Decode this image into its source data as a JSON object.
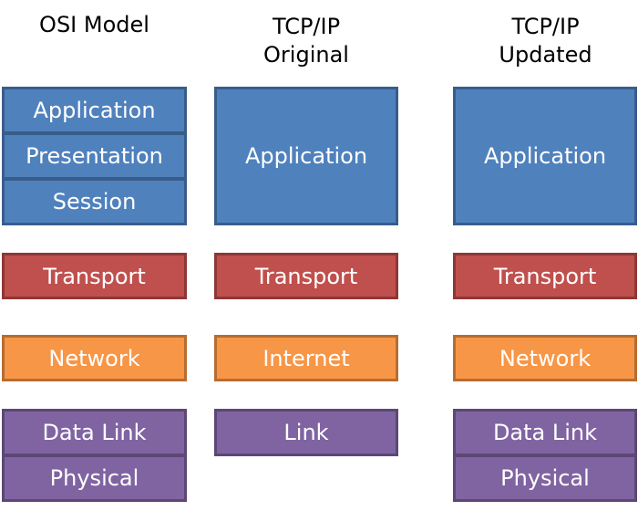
{
  "colors": {
    "application": "#4f81bd",
    "transport": "#c0504d",
    "network": "#f79646",
    "link": "#8064a2"
  },
  "columns": [
    {
      "title": "OSI Model",
      "layers": [
        "Application",
        "Presentation",
        "Session",
        "Transport",
        "Network",
        "Data Link",
        "Physical"
      ]
    },
    {
      "title": "TCP/IP\nOriginal",
      "layers": [
        "Application",
        "Transport",
        "Internet",
        "Link"
      ]
    },
    {
      "title": "TCP/IP\nUpdated",
      "layers": [
        "Application",
        "Transport",
        "Network",
        "Data Link",
        "Physical"
      ]
    }
  ]
}
